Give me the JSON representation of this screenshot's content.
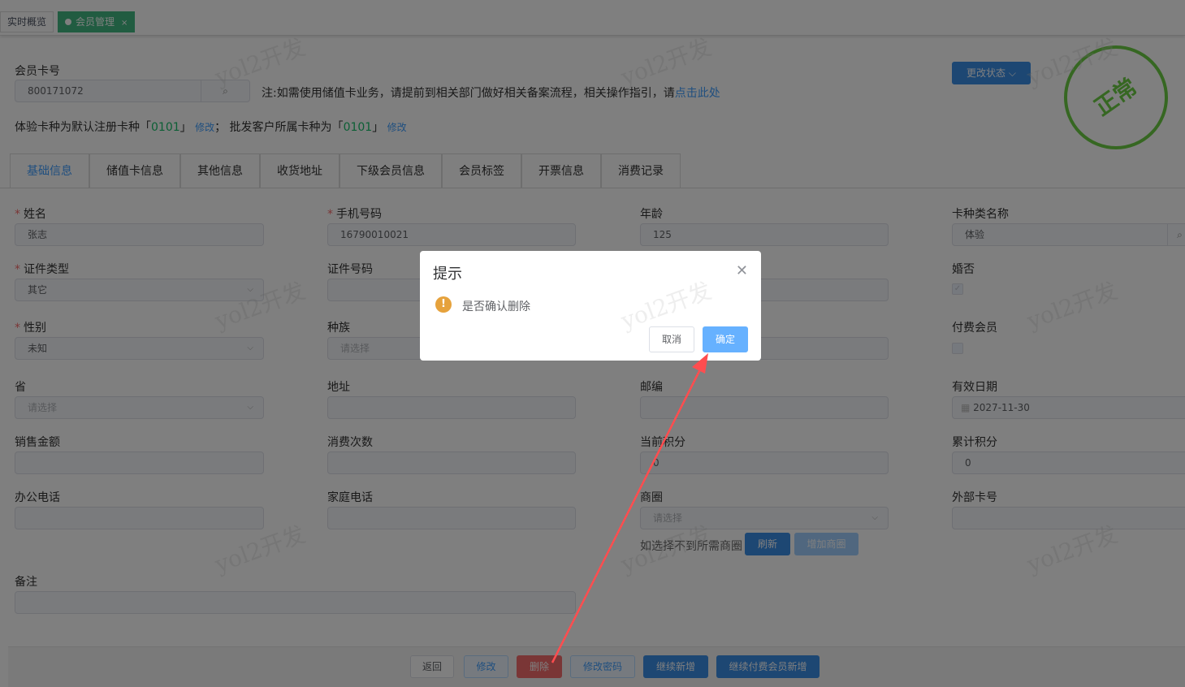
{
  "tags": [
    {
      "label": "实时概览"
    },
    {
      "label": "会员管理",
      "close": "×"
    }
  ],
  "card": {
    "label": "会员卡号",
    "value": "800171072"
  },
  "notice": {
    "text": "注:如需使用储值卡业务，请提前到相关部门做好相关备案流程，相关操作指引，请",
    "link": "点击此处"
  },
  "cardtype": {
    "t1": "体验卡种为默认注册卡种「",
    "code1": "0101",
    "t2": "」",
    "edit1": "修改",
    "t3": "；  批发客户所属卡种为「",
    "code2": "0101",
    "t4": "」",
    "edit2": "修改"
  },
  "status_button": "更改状态",
  "status_stamp": "正常",
  "tabs": [
    "基础信息",
    "储值卡信息",
    "其他信息",
    "收货地址",
    "下级会员信息",
    "会员标签",
    "开票信息",
    "消费记录"
  ],
  "fields": {
    "name": {
      "label": "姓名",
      "value": "张志"
    },
    "phone": {
      "label": "手机号码",
      "value": "16790010021"
    },
    "age": {
      "label": "年龄",
      "value": "125"
    },
    "cardkind": {
      "label": "卡种类名称",
      "value": "体验"
    },
    "idtype": {
      "label": "证件类型",
      "value": "其它"
    },
    "idno": {
      "label": "证件号码",
      "value": ""
    },
    "married": {
      "label": "婚否"
    },
    "gender": {
      "label": "性别",
      "value": "未知"
    },
    "ethnic": {
      "label": "种族",
      "placeholder": "请选择"
    },
    "paid": {
      "label": "付费会员"
    },
    "province": {
      "label": "省",
      "placeholder": "请选择"
    },
    "address": {
      "label": "地址"
    },
    "zip": {
      "label": "邮编"
    },
    "expire": {
      "label": "有效日期",
      "value": "2027-11-30"
    },
    "sales": {
      "label": "销售金额"
    },
    "count": {
      "label": "消费次数"
    },
    "points": {
      "label": "当前积分",
      "value": "0"
    },
    "totalpoints": {
      "label": "累计积分",
      "value": "0"
    },
    "officetel": {
      "label": "办公电话"
    },
    "hometel": {
      "label": "家庭电话"
    },
    "district": {
      "label": "商圈",
      "placeholder": "请选择",
      "hint": "如选择不到所需商圈",
      "refresh": "刷新",
      "add": "增加商圈"
    },
    "extcard": {
      "label": "外部卡号"
    },
    "remark": {
      "label": "备注"
    }
  },
  "footer": [
    "返回",
    "修改",
    "删除",
    "修改密码",
    "继续新增",
    "继续付费会员新增"
  ],
  "watermark": "yol2开发",
  "dialog": {
    "title": "提示",
    "message": "是否确认删除",
    "cancel": "取消",
    "confirm": "确定"
  }
}
